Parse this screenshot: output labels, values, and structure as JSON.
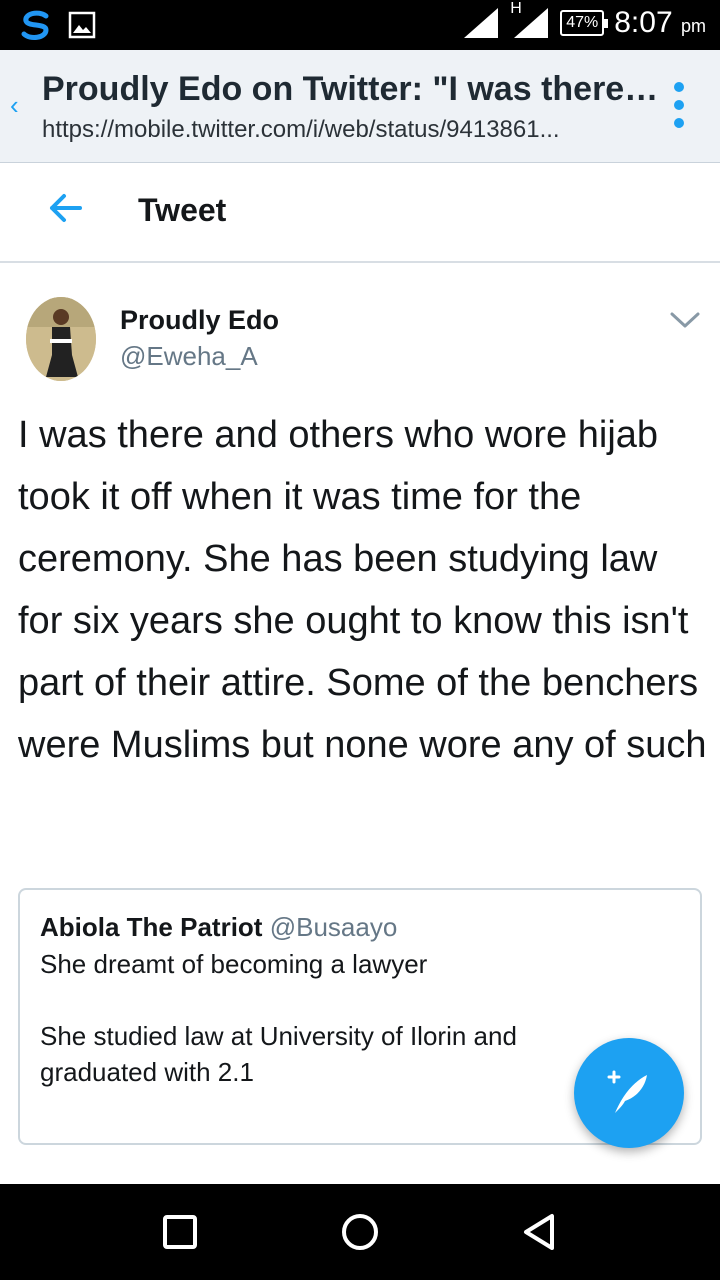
{
  "status_bar": {
    "time": "8:07",
    "ampm": "pm",
    "battery": "47%",
    "network": "H",
    "icons": [
      "app-s-icon",
      "image-notification-icon",
      "signal-icon",
      "signal-h-icon",
      "battery-icon"
    ]
  },
  "browser": {
    "page_title": "Proudly Edo on Twitter: \"I was there a...",
    "url": "https://mobile.twitter.com/i/web/status/9413861...",
    "accent": "#1da1f2"
  },
  "header": {
    "title": "Tweet"
  },
  "tweet": {
    "author_name": "Proudly Edo",
    "author_handle": "@Eweha_A",
    "text": "I was there and others who wore hijab took it off when it was time for the ceremony. She has been studying law for six years she ought to know this isn't part of their attire. Some of the benchers were Muslims but none wore any of such"
  },
  "quoted_tweet": {
    "author_name": "Abiola The Patriot",
    "author_handle": "@Busaayo",
    "line1": "She dreamt of becoming a lawyer",
    "line2": "She studied law at University of Ilorin and graduated with 2.1"
  },
  "colors": {
    "twitter_blue": "#1da1f2",
    "text": "#14171a",
    "muted": "#657786"
  }
}
